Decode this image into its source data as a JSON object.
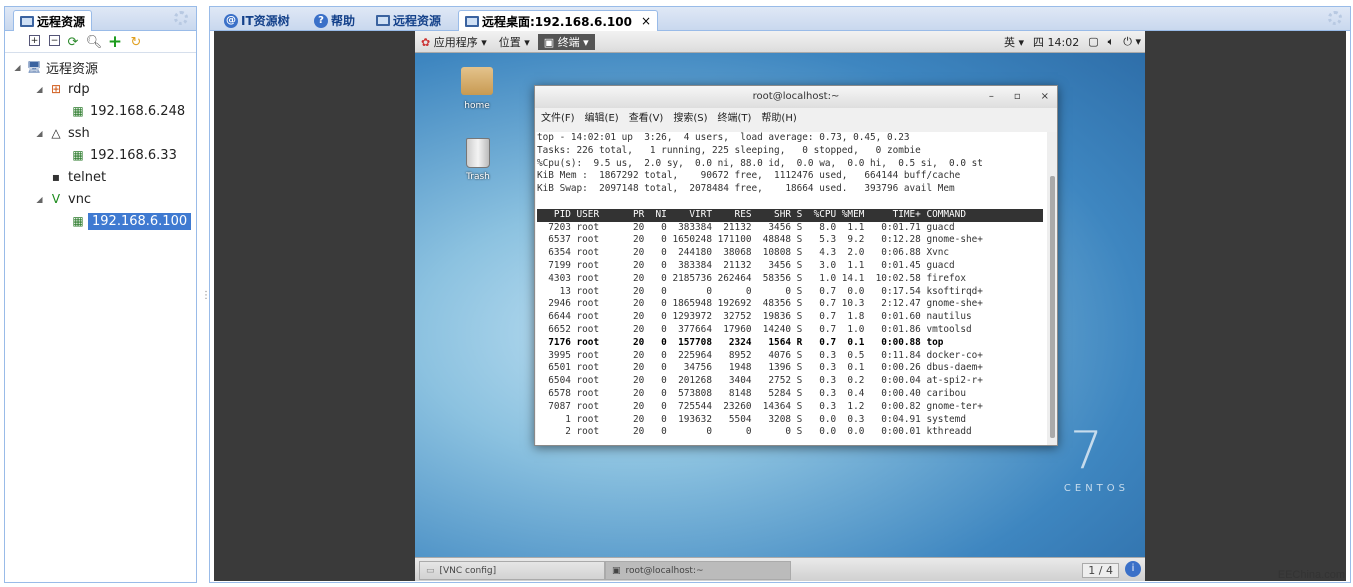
{
  "left_panel": {
    "tab": "远程资源",
    "toolbar": [
      "expand-all",
      "collapse-all",
      "refresh",
      "search",
      "add",
      "reload"
    ],
    "tree": [
      {
        "label": "远程资源",
        "depth": 0,
        "icon": "monitor-icon",
        "expanded": true
      },
      {
        "label": "rdp",
        "depth": 1,
        "icon": "windows-icon",
        "expanded": true
      },
      {
        "label": "192.168.6.248",
        "depth": 2,
        "icon": "server-icon"
      },
      {
        "label": "ssh",
        "depth": 1,
        "icon": "linux-icon",
        "expanded": true
      },
      {
        "label": "192.168.6.33",
        "depth": 2,
        "icon": "server-icon"
      },
      {
        "label": "telnet",
        "depth": 1,
        "icon": "terminal-icon"
      },
      {
        "label": "vnc",
        "depth": 1,
        "icon": "vnc-icon",
        "expanded": true
      },
      {
        "label": "192.168.6.100",
        "depth": 2,
        "icon": "server-icon",
        "selected": true
      }
    ]
  },
  "tabs": [
    {
      "label": "IT资源树",
      "icon": "swirl-icon"
    },
    {
      "label": "帮助",
      "icon": "help-icon"
    },
    {
      "label": "远程资源",
      "icon": "monitor-icon"
    },
    {
      "label": "远程桌面:192.168.6.100",
      "icon": "monitor-icon",
      "active": true,
      "close": "×"
    }
  ],
  "gnome": {
    "apps": "应用程序 ▾",
    "places": "位置 ▾",
    "terminal": "终端 ▾",
    "lang": "英 ▾",
    "clock": "四 14:02"
  },
  "desktop": {
    "home": "home",
    "trash": "Trash",
    "centos7": "7",
    "centos": "CENTOS"
  },
  "terminal": {
    "title": "root@localhost:~",
    "min": "–",
    "max": "▫",
    "close": "×",
    "menu": [
      "文件(F)",
      "编辑(E)",
      "查看(V)",
      "搜索(S)",
      "终端(T)",
      "帮助(H)"
    ],
    "header": [
      "top - 14:02:01 up  3:26,  4 users,  load average: 0.73, 0.45, 0.23",
      "Tasks: 226 total,   1 running, 225 sleeping,   0 stopped,   0 zombie",
      "%Cpu(s):  9.5 us,  2.0 sy,  0.0 ni, 88.0 id,  0.0 wa,  0.0 hi,  0.5 si,  0.0 st",
      "KiB Mem :  1867292 total,    90672 free,  1112476 used,   664144 buff/cache",
      "KiB Swap:  2097148 total,  2078484 free,    18664 used.   393796 avail Mem"
    ],
    "columns": "   PID USER      PR  NI    VIRT    RES    SHR S  %CPU %MEM     TIME+ COMMAND",
    "rows": [
      [
        "7203",
        "root",
        "20",
        "0",
        "383384",
        "21132",
        "3456",
        "S",
        "8.0",
        "1.1",
        "0:01.71",
        "guacd"
      ],
      [
        "6537",
        "root",
        "20",
        "0",
        "1650248",
        "171100",
        "48848",
        "S",
        "5.3",
        "9.2",
        "0:12.28",
        "gnome-she+"
      ],
      [
        "6354",
        "root",
        "20",
        "0",
        "244180",
        "38068",
        "10808",
        "S",
        "4.3",
        "2.0",
        "0:06.88",
        "Xvnc"
      ],
      [
        "7199",
        "root",
        "20",
        "0",
        "383384",
        "21132",
        "3456",
        "S",
        "3.0",
        "1.1",
        "0:01.45",
        "guacd"
      ],
      [
        "4303",
        "root",
        "20",
        "0",
        "2185736",
        "262464",
        "58356",
        "S",
        "1.0",
        "14.1",
        "10:02.58",
        "firefox"
      ],
      [
        "13",
        "root",
        "20",
        "0",
        "0",
        "0",
        "0",
        "S",
        "0.7",
        "0.0",
        "0:17.54",
        "ksoftirqd+"
      ],
      [
        "2946",
        "root",
        "20",
        "0",
        "1865948",
        "192692",
        "48356",
        "S",
        "0.7",
        "10.3",
        "2:12.47",
        "gnome-she+"
      ],
      [
        "6644",
        "root",
        "20",
        "0",
        "1293972",
        "32752",
        "19836",
        "S",
        "0.7",
        "1.8",
        "0:01.60",
        "nautilus"
      ],
      [
        "6652",
        "root",
        "20",
        "0",
        "377664",
        "17960",
        "14240",
        "S",
        "0.7",
        "1.0",
        "0:01.86",
        "vmtoolsd"
      ],
      [
        "7176",
        "root",
        "20",
        "0",
        "157708",
        "2324",
        "1564",
        "R",
        "0.7",
        "0.1",
        "0:00.88",
        "top"
      ],
      [
        "3995",
        "root",
        "20",
        "0",
        "225964",
        "8952",
        "4076",
        "S",
        "0.3",
        "0.5",
        "0:11.84",
        "docker-co+"
      ],
      [
        "6501",
        "root",
        "20",
        "0",
        "34756",
        "1948",
        "1396",
        "S",
        "0.3",
        "0.1",
        "0:00.26",
        "dbus-daem+"
      ],
      [
        "6504",
        "root",
        "20",
        "0",
        "201268",
        "3404",
        "2752",
        "S",
        "0.3",
        "0.2",
        "0:00.04",
        "at-spi2-r+"
      ],
      [
        "6578",
        "root",
        "20",
        "0",
        "573808",
        "8148",
        "5284",
        "S",
        "0.3",
        "0.4",
        "0:00.40",
        "caribou"
      ],
      [
        "7087",
        "root",
        "20",
        "0",
        "725544",
        "23260",
        "14364",
        "S",
        "0.3",
        "1.2",
        "0:00.82",
        "gnome-ter+"
      ],
      [
        "1",
        "root",
        "20",
        "0",
        "193632",
        "5504",
        "3208",
        "S",
        "0.0",
        "0.3",
        "0:04.91",
        "systemd"
      ],
      [
        "2",
        "root",
        "20",
        "0",
        "0",
        "0",
        "0",
        "S",
        "0.0",
        "0.0",
        "0:00.01",
        "kthreadd"
      ]
    ]
  },
  "taskbar": {
    "vnc_config": "[VNC config]",
    "term": "root@localhost:~",
    "pager": "1 / 4",
    "info": "i"
  },
  "watermark": "EEChina.com"
}
